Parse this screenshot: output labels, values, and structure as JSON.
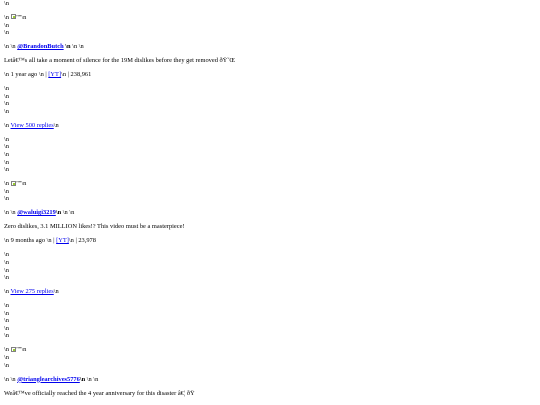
{
  "newline_glyph": "\\n",
  "comments": [
    {
      "img_alt": "\"\"",
      "author": "@BrandonButch",
      "text": "Letâ€™s all take a moment of silence for the 19M dislikes before they get removed ðŸ˜Œ",
      "age": "1 year ago",
      "source_link": "[YT]",
      "likes": "238,961",
      "replies_link": "View 500 replies"
    },
    {
      "img_alt": "\"\"",
      "author": "@waluigi3219",
      "text": "Zero dislikes, 3.1 MILLION likes!? This video must be a masterpiece!",
      "age": "9 months ago",
      "source_link": "[YT]",
      "likes": "23,978",
      "replies_link": "View 275 replies"
    },
    {
      "img_alt": "\"\"",
      "author": "@trianglearchives5776",
      "text": "Weâ€™ve officially reached the 4 year anniversary for this disaster â€¦ ðŸ",
      "age": "",
      "source_link": "",
      "likes": "",
      "replies_link": ""
    }
  ]
}
